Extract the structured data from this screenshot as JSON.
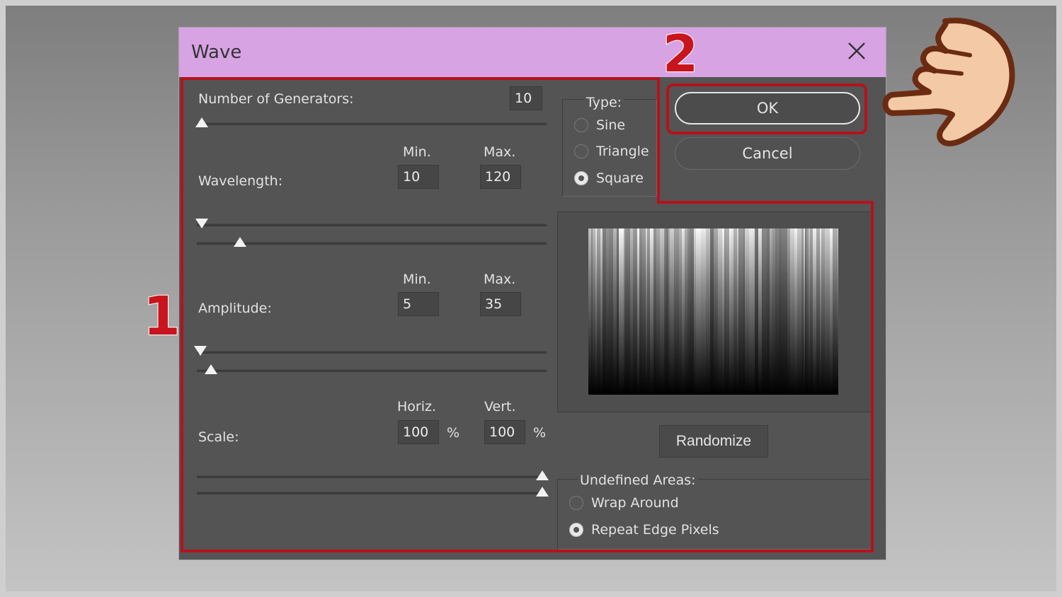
{
  "dialog": {
    "title": "Wave"
  },
  "generators": {
    "label": "Number of Generators:",
    "value": "10",
    "slider_fraction": 0.0
  },
  "wavelength": {
    "label": "Wavelength:",
    "min_label": "Min.",
    "max_label": "Max.",
    "min_value": "10",
    "max_value": "120"
  },
  "amplitude": {
    "label": "Amplitude:",
    "min_label": "Min.",
    "max_label": "Max.",
    "min_value": "5",
    "max_value": "35"
  },
  "scale": {
    "label": "Scale:",
    "horiz_label": "Horiz.",
    "vert_label": "Vert.",
    "horiz_value": "100",
    "vert_value": "100",
    "unit": "%"
  },
  "type": {
    "label": "Type:",
    "options": [
      "Sine",
      "Triangle",
      "Square"
    ],
    "selected": "Square"
  },
  "buttons": {
    "ok": "OK",
    "cancel": "Cancel",
    "randomize": "Randomize"
  },
  "undefined_areas": {
    "label": "Undefined Areas:",
    "options": [
      "Wrap Around",
      "Repeat Edge Pixels"
    ],
    "selected": "Repeat Edge Pixels"
  },
  "annotations": {
    "step1": "1",
    "step2": "2",
    "highlight_color": "#b5121b"
  },
  "icons": {
    "close": "close-icon",
    "pointer": "pointing-hand-icon"
  }
}
